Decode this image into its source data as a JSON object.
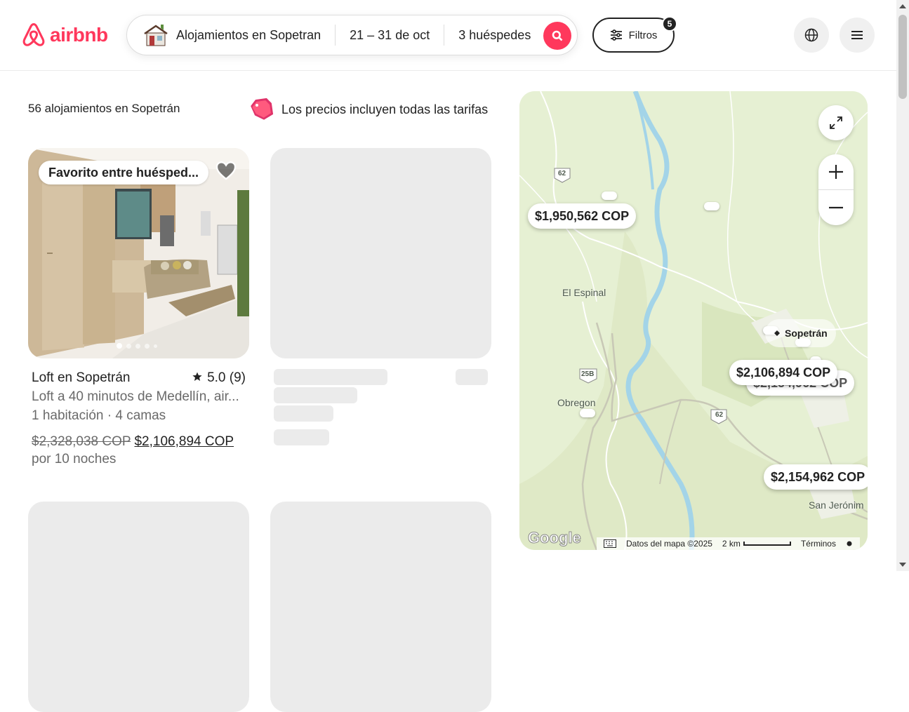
{
  "header": {
    "logo_text": "airbnb",
    "search": {
      "location": "Alojamientos en Sopetran",
      "dates": "21 – 31 de oct",
      "guests": "3 huéspedes"
    },
    "filters": {
      "label": "Filtros",
      "count": "5"
    }
  },
  "results": {
    "count_label": "56 alojamientos en Sopetrán",
    "price_note": "Los precios incluyen todas las tarifas"
  },
  "listings": [
    {
      "badge": "Favorito entre huésped...",
      "title": "Loft en Sopetrán",
      "rating": "5.0 (9)",
      "description": "Loft a 40 minutos de Medellín, air...",
      "rooms": "1 habitación · 4 camas",
      "old_price": "$2,328,038 COP",
      "price": "$2,106,894 COP",
      "period": "por 10 noches",
      "photo_count": 5
    }
  ],
  "map": {
    "pins": [
      {
        "label": "$1,950,562 COP"
      },
      {
        "label": "$2,106,894 COP"
      },
      {
        "label": "$2,154,962 COP"
      }
    ],
    "hidden_pin_label": "$2,154,962 COP",
    "places": {
      "espinal": "El Espinal",
      "sopetran": "Sopetrán",
      "obregon": "Obregon",
      "san_jeronimo": "San Jerónim"
    },
    "roads": {
      "r62": "62",
      "r25b": "25B"
    },
    "footer": {
      "google": "Google",
      "data": "Datos del mapa ©2025",
      "scale": "2 km",
      "terms": "Términos"
    }
  },
  "colors": {
    "brand": "#ff385c",
    "text": "#222222",
    "muted": "#6a6a6a"
  }
}
